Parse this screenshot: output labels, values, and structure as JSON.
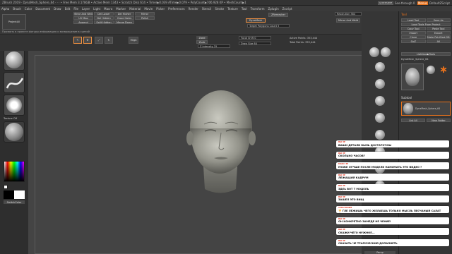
{
  "titlebar": {
    "text": "ZBrush 2019 · DynaMesh_Sphere_64 · · · • Free Mem 3.178GB • Active Mem 1343 • Scratch Disk 614 • Timer▶0.039 ATime▶0.079 • PolyCount▶706.928 KP • MeshCount▶1",
    "quicksave": "QuickSave",
    "see_through": "See-through 0",
    "menus_label": "Menus",
    "default_script": "DefaultZScript"
  },
  "menubar": [
    "Alpha",
    "Brush",
    "Color",
    "Document",
    "Draw",
    "Edit",
    "File",
    "Layer",
    "Light",
    "Macro",
    "Marker",
    "Material",
    "Movie",
    "Picker",
    "Preferences",
    "Render",
    "Stencil",
    "Stroke",
    "Texture",
    "Tool",
    "Transform",
    "Zplugin",
    "Zscript"
  ],
  "topshelf": {
    "projectall": "ProjectAll",
    "b1": "Mirror And Weld",
    "b2": "Del Lower",
    "b3": "Del Higher",
    "b4": "Mirror",
    "b5": "UV Map",
    "b6": "Del Hidden",
    "b7": "Close Holes",
    "b8": "Polish",
    "b9": "Append",
    "b10": "Split Hidden",
    "b11": "Merge Down",
    "dynamesh": "DynaMesh",
    "zremesher": "ZRemesher",
    "resolution": "Resolution 384",
    "target_poly": "Target Polygons Count 5",
    "mirror_weld": "Mirror And Weld",
    "hint": "Прозвать в проекте фигуры информацию и возвращение в сценой"
  },
  "toolrow": {
    "draw": "Draw",
    "move": "Move",
    "scale": "Scale",
    "rotate": "Rotate",
    "zadd": "Zadd",
    "zsub": "Zsub",
    "zcut": "Zcut",
    "rgb_intensity": "Rgb Intensity 100",
    "z_intensity": "Z Intensity 25",
    "focal_shift": "Focal Shift 0",
    "draw_size": "Draw Size 64",
    "active_points": "Active Points: 353,444",
    "total_points": "Total Points: 353,444",
    "mrgb": "Mrgb",
    "rgb": "Rgb",
    "m": "M"
  },
  "leftshelf": {
    "brush_label": "Standard",
    "stroke_label": "DragRect",
    "alpha_label": "Alpha Off",
    "texture_label": "Texture Off",
    "material_label": "MatCap Gray",
    "gradient": "Gradient",
    "switchcolor": "SwitchColor",
    "alternate": "Alternate"
  },
  "rightshelf": {
    "scroll": "Scroll",
    "zoom": "Zoom",
    "actual": "Actual",
    "aahalf": "AAHalf",
    "persp": "Persp",
    "floor": "Floor",
    "local": "Local",
    "xyz": "Gxyz",
    "frame": "Frame",
    "move": "Move",
    "zoom3d": "Zoom3D",
    "rotate": "Rotate",
    "polyf": "PolyF",
    "transp": "Transp",
    "solo": "Solo"
  },
  "rightpanel": {
    "tool_title": "Tool",
    "load_tool": "Load Tool",
    "save_as": "Save As",
    "load_tools_project": "Load Tools From Project",
    "copy_tool": "Copy Tool",
    "paste_tool": "Paste Tool",
    "import": "Import",
    "export": "Export",
    "clone": "Clone",
    "make_polymesh": "Make PolyMesh3D",
    "goz": "GoZ",
    "all": "All",
    "visible": "Visible",
    "r": "R",
    "lightbox_tools": "Lightbox▶Tools",
    "current_tool": "DynaMesh_Sphere_64",
    "tool_count": "48",
    "subtool": "Subtool",
    "list_all": "List All",
    "new_folder": "New Folder"
  },
  "chat": [
    {
      "name": "ВЫ ЗЕ",
      "msg": "ВАШИ ДЕТАЛИ БЫЛЬ ДОСТАТОЧНЫ"
    },
    {
      "name": "ВЫ ЗЕ",
      "msg": "СКОЛЬКО ЧАСОВ?"
    },
    {
      "name": "МАКС ЗЕ",
      "msg": "МОЖЕ ЛУЧШЕ ПОСЛЕ МОДЕЛИ НАНИМАТЬ ЭТО ВИДЕО ?"
    },
    {
      "name": "ВЫ ЗЕ",
      "msg": "ЛЕЖАЩИЙ КАДРУМ"
    },
    {
      "name": "ВЫ ЗЕ",
      "msg": "ЗДЕЬ ВОТ Т МОДЕЛЬ"
    },
    {
      "name": "ВЫ ЗЕ",
      "msg": "ЗАШЕЛ ЭТО ВИЩ"
    },
    {
      "name": "ТЕКСТИЛИЯ",
      "msg": "🏆 ГЛЕ ЛЕЖИШЬ ЧЕГО ЖЕЛАЕШЬ ТОЛЬКО МЫСЛЬ ПЕСЧАНЫЙ САЛАТ"
    },
    {
      "name": "ВЫ ЗЕ",
      "msg": "ОН КОНКРЕТНО ЗАМЕДЕ НЕ ЧЕНИЕ!"
    },
    {
      "name": "ВЫ ЗЕ",
      "msg": "СКАЖИ ЧЕГО НУЖНОЕ..."
    },
    {
      "name": "ВЫ ЗЕ",
      "msg": "СКАЗАТЬ ЧЕ ТРАГИЧЕСКИЙ ДОПАЛНЕТЬ"
    }
  ]
}
